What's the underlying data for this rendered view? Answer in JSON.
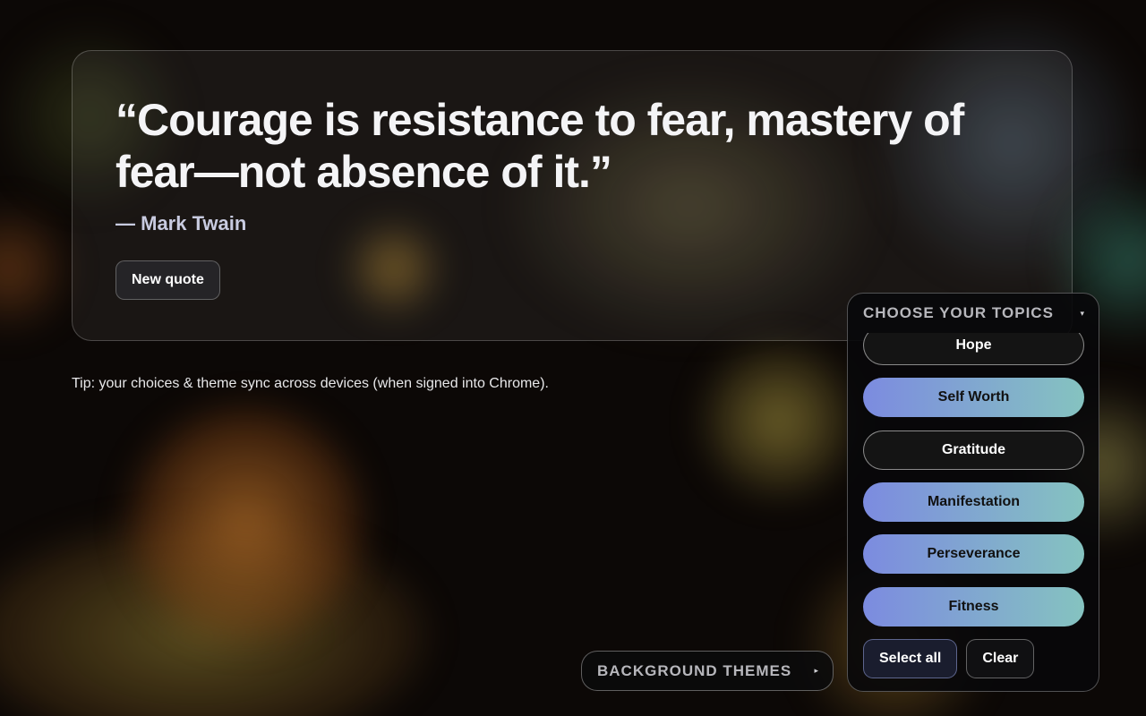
{
  "quote": {
    "text": "“Courage is resistance to fear, mastery of fear—not absence of it.”",
    "author": "— Mark Twain",
    "new_quote_label": "New quote"
  },
  "tip": "Tip: your choices & theme sync across devices (when signed into Chrome).",
  "background_themes": {
    "label": "BACKGROUND THEMES",
    "caret": "▸"
  },
  "topics": {
    "title": "CHOOSE YOUR TOPICS",
    "caret": "▾",
    "items": [
      {
        "label": "Hope",
        "selected": false
      },
      {
        "label": "Self Worth",
        "selected": true
      },
      {
        "label": "Gratitude",
        "selected": false
      },
      {
        "label": "Manifestation",
        "selected": true
      },
      {
        "label": "Perseverance",
        "selected": true
      },
      {
        "label": "Fitness",
        "selected": true
      }
    ],
    "select_all_label": "Select all",
    "clear_label": "Clear"
  },
  "colors": {
    "selected_gradient_start": "#7c8be0",
    "selected_gradient_end": "#85c3c0"
  }
}
